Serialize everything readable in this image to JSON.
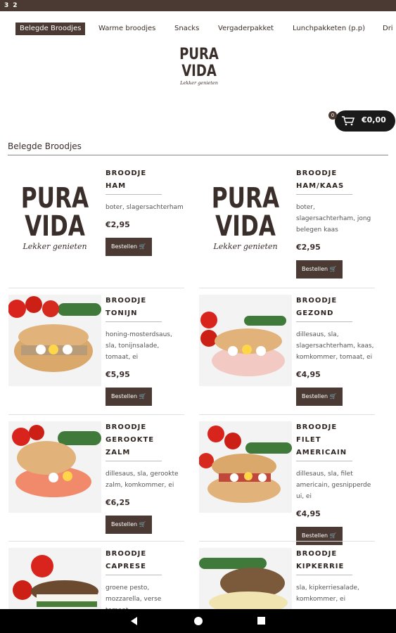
{
  "status_bar": {
    "left1": "3",
    "left2": "2"
  },
  "nav": {
    "items": [
      "Belegde Broodjes",
      "Warme broodjes",
      "Snacks",
      "Vergaderpakket",
      "Lunchpakketen (p.p)",
      "Dri"
    ]
  },
  "logo": {
    "line1": "PURA",
    "line2": "VIDA",
    "tagline": "Lekker genieten"
  },
  "cart": {
    "badge": "0",
    "amount": "€0,00"
  },
  "section": {
    "title": "Belegde Broodjes"
  },
  "products": [
    {
      "name1": "BROODJE",
      "name2": "HAM",
      "name3": "",
      "desc": "boter, slagersachterham",
      "price": "€2,95",
      "button": "Bestellen",
      "image": "logo-placeholder"
    },
    {
      "name1": "BROODJE",
      "name2": "HAM/KAAS",
      "name3": "",
      "desc": "boter, slagersachterham, jong belegen kaas",
      "price": "€2,95",
      "button": "Bestellen",
      "image": "logo-placeholder"
    },
    {
      "name1": "BROODJE",
      "name2": "TONIJN",
      "name3": "",
      "desc": "honing-mosterdsaus, sla, tonijnsalade, tomaat, ei",
      "price": "€5,95",
      "button": "Bestellen",
      "image": "sandwich-tuna"
    },
    {
      "name1": "BROODJE",
      "name2": "GEZOND",
      "name3": "",
      "desc": "dillesaus, sla, slagersachterham, kaas, komkommer, tomaat, ei",
      "price": "€4,95",
      "button": "Bestellen",
      "image": "sandwich-healthy"
    },
    {
      "name1": "BROODJE",
      "name2": "GEROOKTE",
      "name3": "ZALM",
      "desc": "dillesaus, sla, gerookte zalm, komkommer, ei",
      "price": "€6,25",
      "button": "Bestellen",
      "image": "sandwich-salmon"
    },
    {
      "name1": "BROODJE",
      "name2": "FILET",
      "name3": "AMERICAIN",
      "desc": "dillesaus, sla, filet americain, gesnipperde ui, ei",
      "price": "€4,95",
      "button": "Bestellen",
      "image": "sandwich-filet"
    },
    {
      "name1": "BROODJE",
      "name2": "CAPRESE",
      "name3": "",
      "desc": "groene pesto, mozzarella, verse tomaat",
      "price": "",
      "button": "",
      "image": "sandwich-caprese"
    },
    {
      "name1": "BROODJE",
      "name2": "KIPKERRIE",
      "name3": "",
      "desc": "sla, kipkerriesalade, komkommer, ei",
      "price": "",
      "button": "",
      "image": "sandwich-chicken"
    }
  ]
}
